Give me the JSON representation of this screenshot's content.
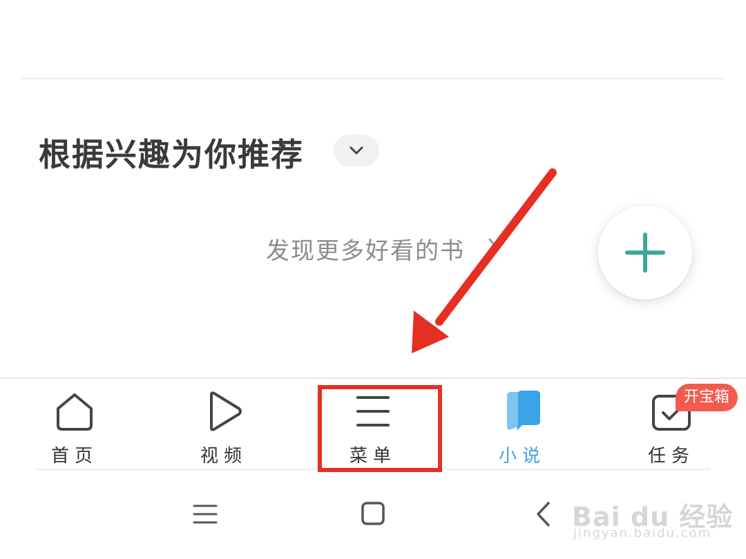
{
  "recommend": {
    "title": "根据兴趣为你推荐",
    "dropdown_icon": "chevron-down-icon",
    "discover_text": "发现更多好看的书"
  },
  "fab": {
    "icon": "plus-icon",
    "color": "#3aa89a"
  },
  "bottom_nav": {
    "items": [
      {
        "label": "首页",
        "icon": "home-icon",
        "active": false
      },
      {
        "label": "视频",
        "icon": "play-icon",
        "active": false
      },
      {
        "label": "菜单",
        "icon": "menu-icon",
        "active": false,
        "highlighted": true
      },
      {
        "label": "小说",
        "icon": "book-icon",
        "active": true
      },
      {
        "label": "任务",
        "icon": "task-check-icon",
        "active": false,
        "badge": "开宝箱"
      }
    ],
    "active_color": "#3aa3e6",
    "badge_color": "#f25b4e"
  },
  "system_nav": {
    "buttons": [
      "recents-icon",
      "home-square-icon",
      "back-icon"
    ]
  },
  "annotation": {
    "arrow_color": "#e52f22",
    "box_color": "#e52f22"
  },
  "watermark": {
    "brand": "Bai du 经验",
    "url": "jingyan.baidu.com"
  }
}
